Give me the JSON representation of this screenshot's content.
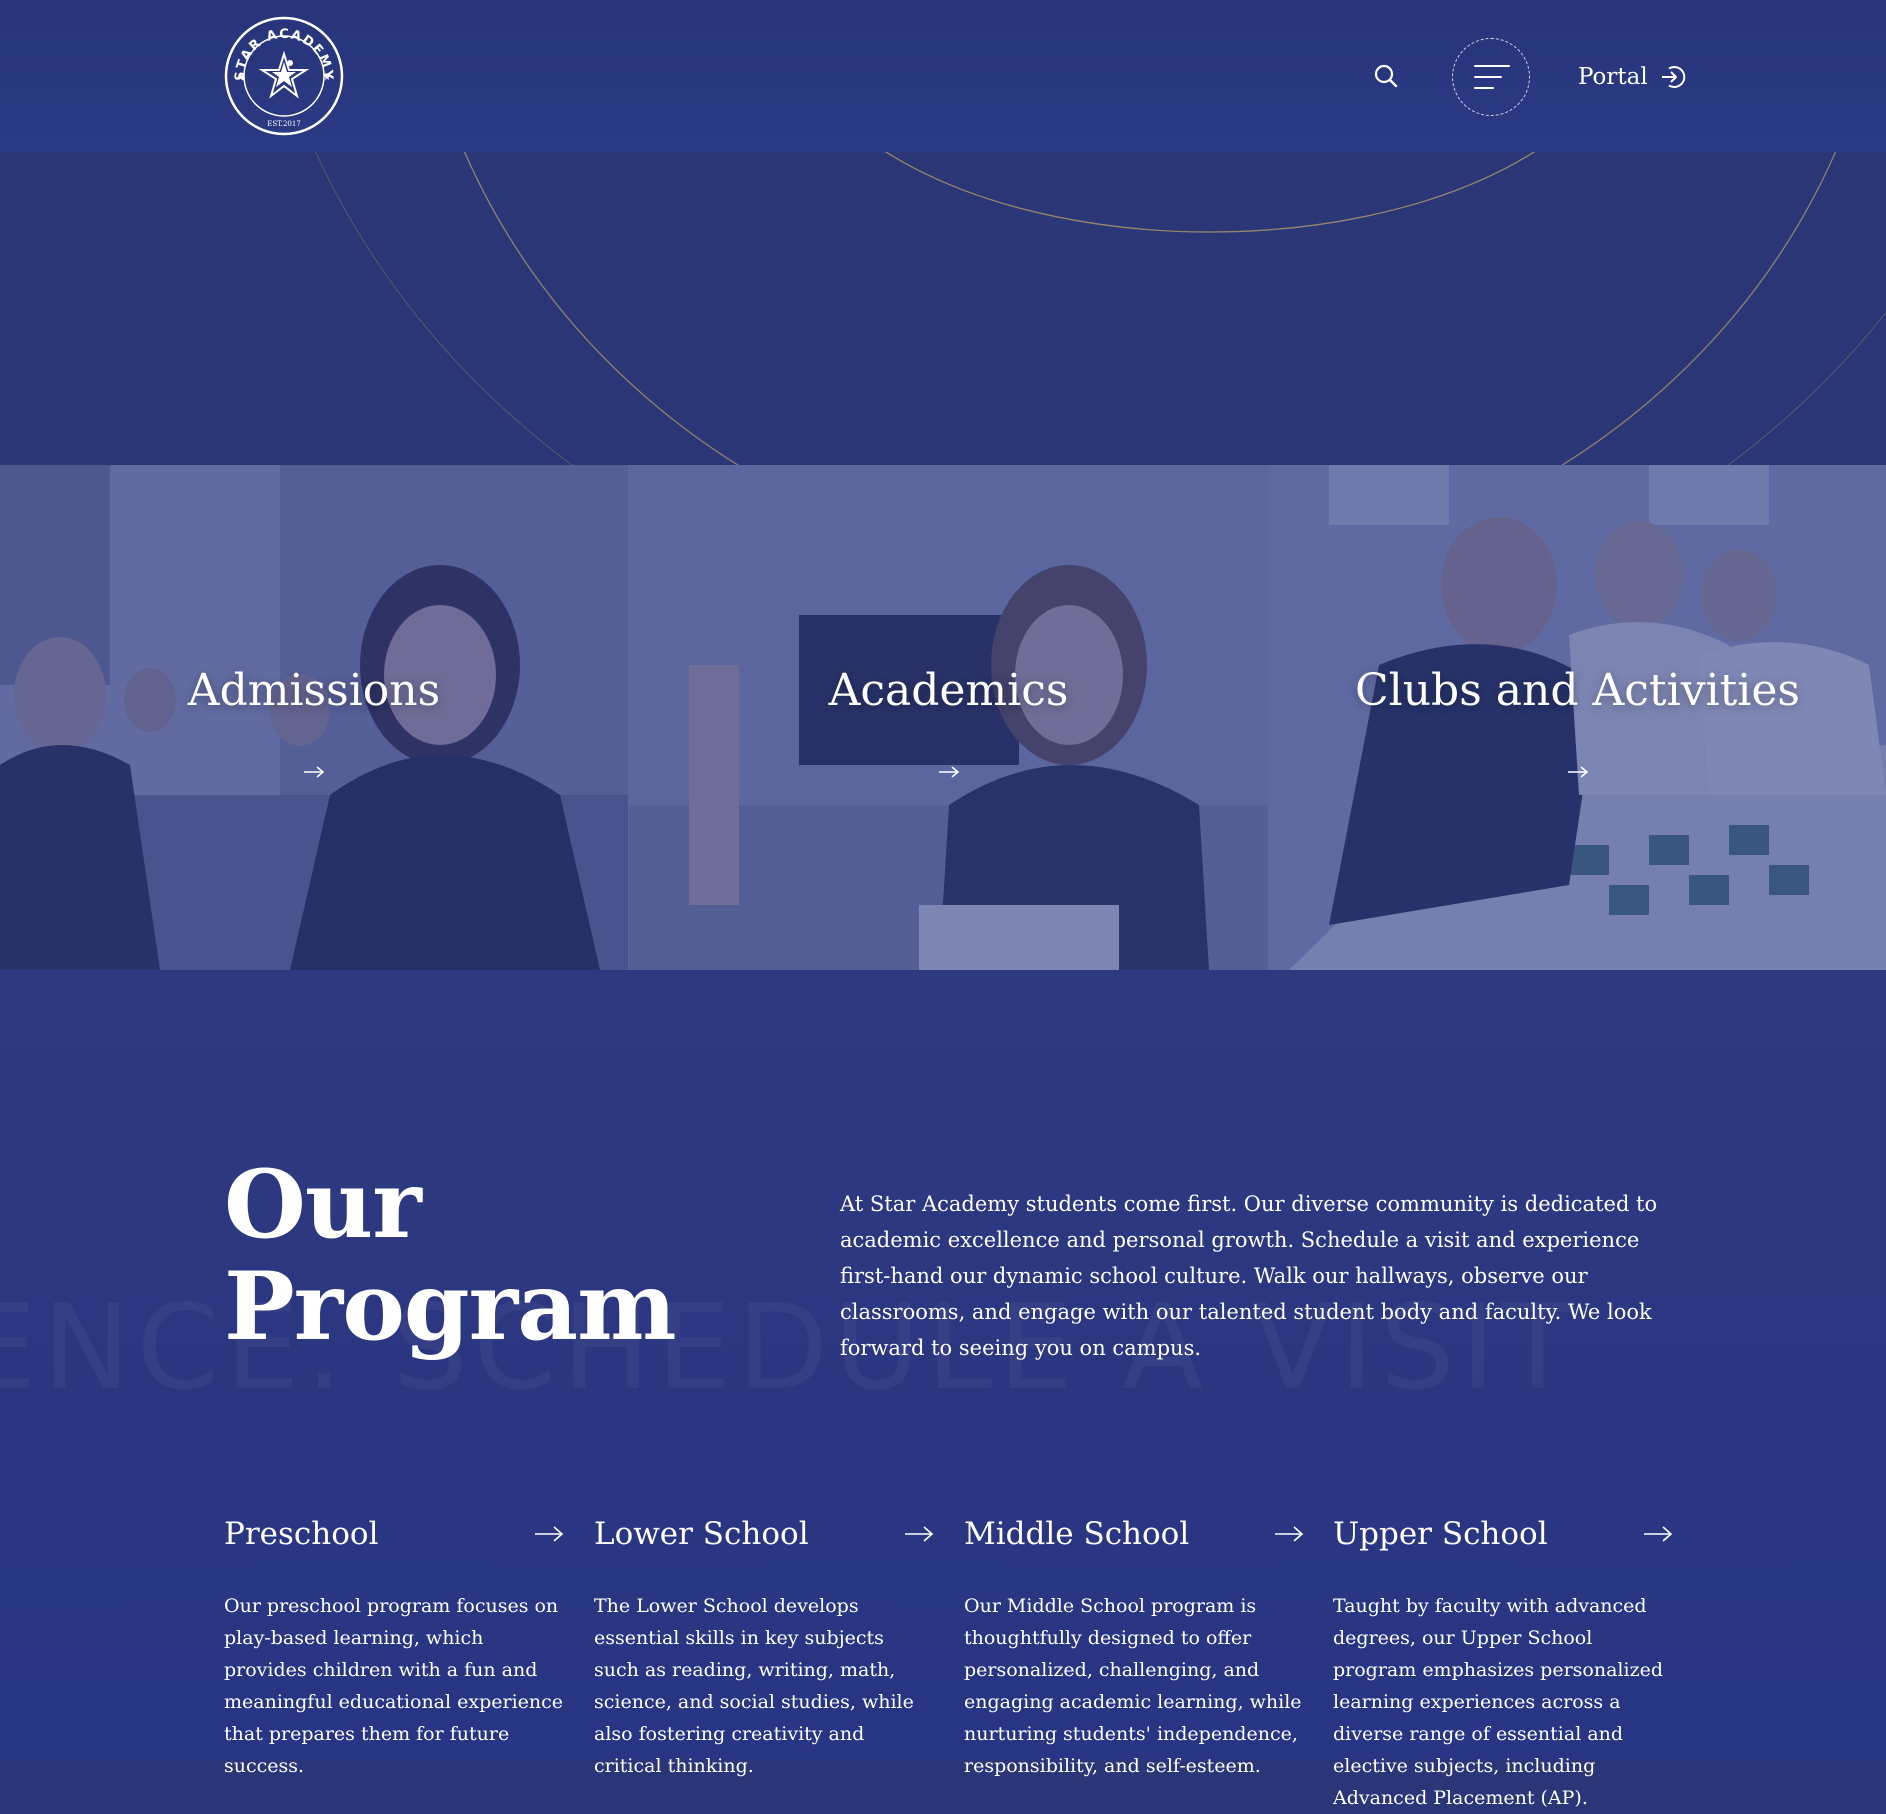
{
  "brand": {
    "name": "STAR ACADEMY",
    "established": "EST.2017"
  },
  "header": {
    "search_icon": "search-icon",
    "menu_icon": "hamburger-menu-icon",
    "portal_label": "Portal",
    "portal_icon": "sign-in-icon"
  },
  "tiles": [
    {
      "title": "Admissions",
      "icon": "arrow-right-icon"
    },
    {
      "title": "Academics",
      "icon": "arrow-right-icon"
    },
    {
      "title": "Clubs and Activities",
      "icon": "arrow-right-icon"
    }
  ],
  "program": {
    "title_line1": "Our",
    "title_line2": "Program",
    "watermark": "LENCE. SCHEDULE A VISIT",
    "intro": "At Star Academy students come first. Our diverse community is dedicated to academic excellence and personal growth. Schedule a visit and experience first-hand our dynamic school culture. Walk our hallways, observe our classrooms, and engage with our talented student body and faculty. We look forward to seeing you on campus.",
    "schools": [
      {
        "name": "Preschool",
        "description": "Our preschool program focuses on play-based learning, which provides children with a fun and meaningful educational experience that prepares them for future success."
      },
      {
        "name": "Lower School",
        "description": "The Lower School develops essential skills in key subjects such as reading, writing, math, science, and social studies, while also fostering creativity and critical thinking."
      },
      {
        "name": "Middle School",
        "description": "Our Middle School program is thoughtfully designed to offer personalized, challenging, and engaging academic learning, while nurturing students' independence, responsibility, and self-esteem."
      },
      {
        "name": "Upper School",
        "description": "Taught by faculty with advanced degrees, our Upper School program emphasizes personalized learning experiences across a diverse range of essential and elective subjects, including Advanced Placement (AP)."
      }
    ]
  },
  "colors": {
    "background": "#2a3678",
    "accent_line": "#b29a6a",
    "text": "#ffffff"
  }
}
